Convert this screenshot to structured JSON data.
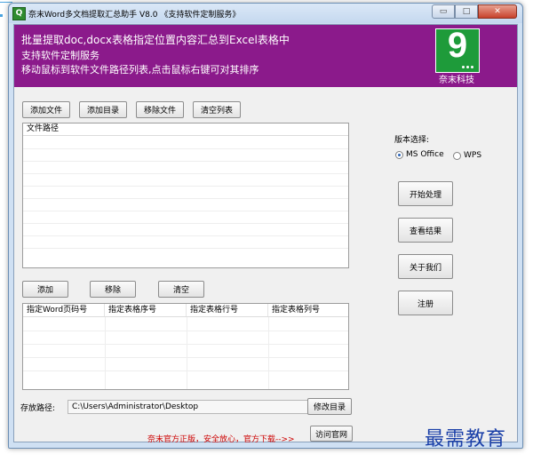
{
  "window": {
    "title": "奈末Word多文档提取汇总助手 V8.0 《支持软件定制服务》",
    "app_icon_letter": "Q",
    "controls": {
      "minimize": "▭",
      "maximize": "□",
      "close": "✕"
    }
  },
  "banner": {
    "lines": [
      "批量提取doc,docx表格指定位置内容汇总到Excel表格中",
      "支持软件定制服务",
      "移动鼠标到软件文件路径列表,点击鼠标右键可对其排序"
    ],
    "logo_digit": "9",
    "logo_caption": "奈末科技",
    "background_color": "#8b1a8b",
    "logo_color": "#1e9b3a"
  },
  "file_toolbar": {
    "add_file": "添加文件",
    "add_dir": "添加目录",
    "remove_file": "移除文件",
    "clear_list": "清空列表"
  },
  "file_list": {
    "header": "文件路径",
    "rows": []
  },
  "param_toolbar": {
    "add": "添加",
    "remove": "移除",
    "clear": "清空"
  },
  "param_table": {
    "columns": [
      "指定Word页码号",
      "指定表格序号",
      "指定表格行号",
      "指定表格列号"
    ],
    "rows": []
  },
  "version": {
    "label": "版本选择:",
    "options": [
      {
        "label": "MS Office",
        "selected": true
      },
      {
        "label": "WPS",
        "selected": false
      }
    ]
  },
  "actions": {
    "start": "开始处理",
    "view_result": "查看结果",
    "about": "关于我们",
    "register": "注册"
  },
  "save": {
    "label": "存放路径:",
    "path": "C:\\Users\\Administrator\\Desktop",
    "change_dir": "修改目录"
  },
  "footer": {
    "notice": "奈末官方正版，安全放心，官方下载-->>",
    "visit_site": "访问官网",
    "notice_color": "#cc0000"
  },
  "watermark": "最需教育"
}
